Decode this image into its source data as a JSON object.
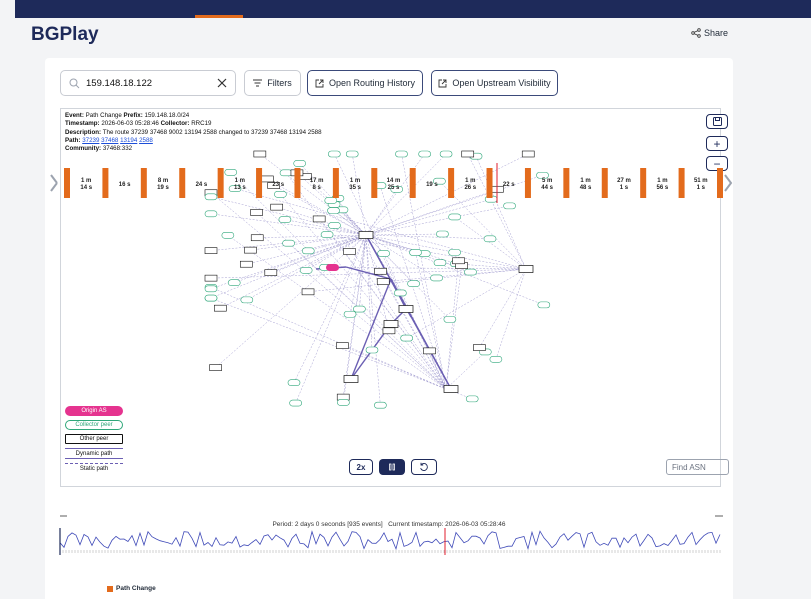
{
  "app": {
    "title": "BGPlay",
    "share_label": "Share"
  },
  "toolbar": {
    "search_value": "159.148.18.122",
    "filters_label": "Filters",
    "routing_label": "Open Routing History",
    "upstream_label": "Open Upstream Visibility"
  },
  "event": {
    "event_label": "Event:",
    "event_value": "Path Change",
    "prefix_label": "Prefix:",
    "prefix_value": "159.148.18.0/24",
    "timestamp_label": "Timestamp:",
    "timestamp_value": "2026-06-03 05:28:46",
    "collector_label": "Collector:",
    "collector_value": "RRC19",
    "description_label": "Description:",
    "description_value": "The route 37239 37468 9002 13194 2588 changed to 37239 37468 13194 2588",
    "path_label": "Path:",
    "path": [
      "37239",
      "37468",
      "13194",
      "2588"
    ],
    "community_label": "Community:",
    "community_value": "37468:332"
  },
  "legend": {
    "origin": "Origin AS",
    "collector": "Collector peer",
    "other": "Other peer",
    "dynamic": "Dynamic path",
    "static": "Static path"
  },
  "playback": {
    "speed_label": "2x",
    "find_placeholder": "Find ASN"
  },
  "timeline": {
    "period_text": "Period: 2 days 0 seconds [935 events]",
    "current_text": "Current timestamp: 2026-06-03 05:28:46",
    "event_type": "Path Change",
    "intervals": [
      "1 m\n14 s",
      "16 s",
      "8 m\n19 s",
      "24 s",
      "1 m\n13 s",
      "23 s",
      "17 m\n8 s",
      "1 m\n35 s",
      "14 m\n25 s",
      "19 s",
      "1 m\n26 s",
      "22 s",
      "5 m\n44 s",
      "1 m\n48 s",
      "27 m\n1 s",
      "1 m\n56 s",
      "51 m\n1 s"
    ]
  },
  "colors": {
    "brand": "#1e2a5a",
    "accent": "#e36b1c",
    "origin": "#e5338f",
    "collector": "#2fa77a",
    "path": "#6b5fb3"
  }
}
